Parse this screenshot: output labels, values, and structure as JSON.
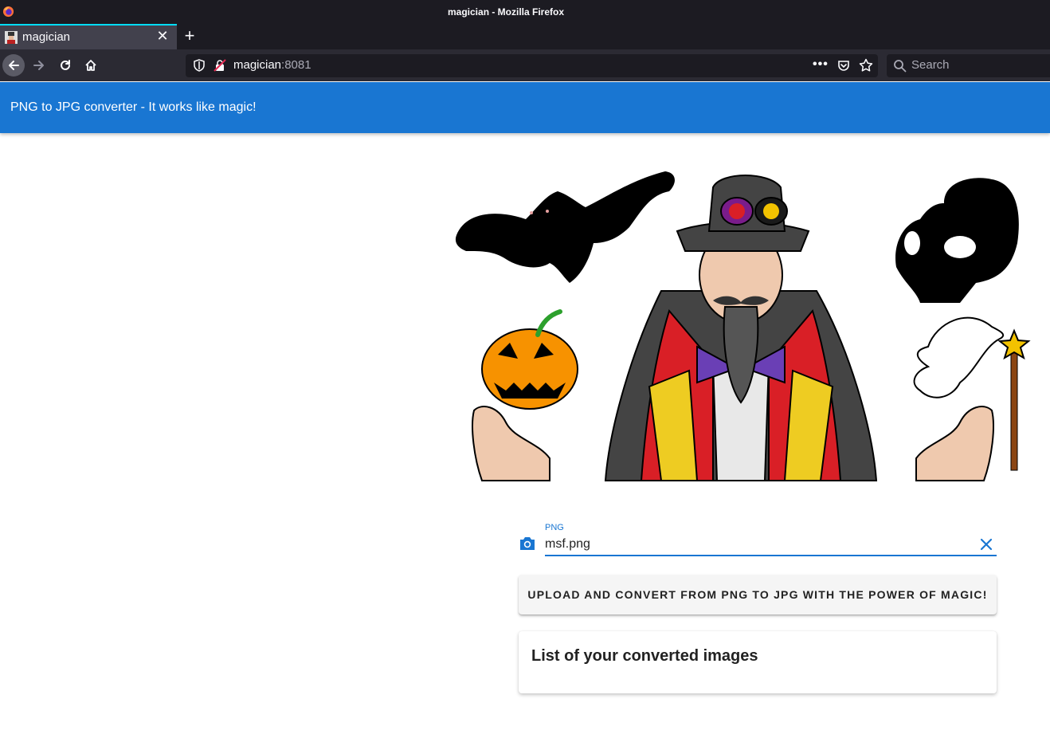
{
  "window": {
    "title": "magician - Mozilla Firefox"
  },
  "tabs": [
    {
      "label": "magician"
    }
  ],
  "toolbar": {
    "url_host": "magician",
    "url_port": ":8081",
    "search_placeholder": "Search",
    "more_label": "•••"
  },
  "app": {
    "title": "PNG to JPG converter - It works like magic!"
  },
  "form": {
    "file_label": "PNG",
    "file_value": "msf.png",
    "submit_label": "UPLOAD AND CONVERT FROM PNG TO JPG WITH THE POWER OF MAGIC!"
  },
  "list": {
    "title": "List of your converted images",
    "items": []
  },
  "colors": {
    "primary": "#1976d2",
    "titlebar": "#1c1b22",
    "toolbar": "#2b2a33"
  }
}
